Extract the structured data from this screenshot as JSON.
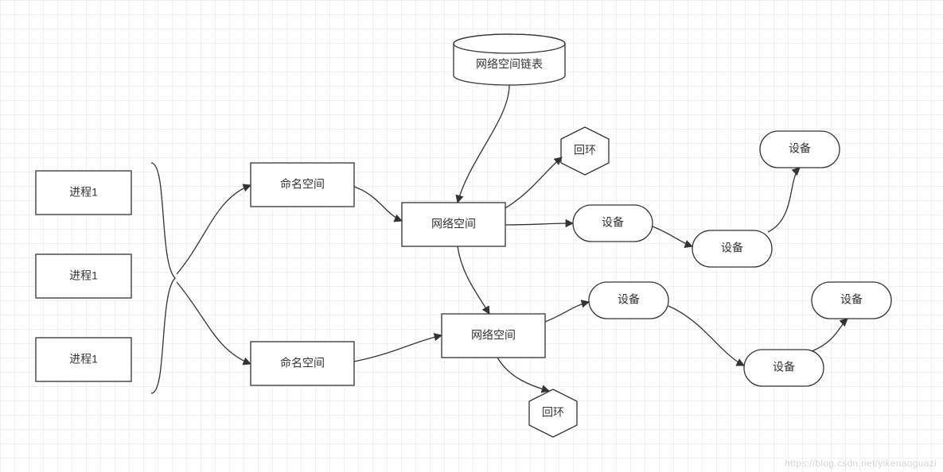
{
  "nodes": {
    "proc1": "进程1",
    "proc2": "进程1",
    "proc3": "进程1",
    "ns1": "命名空间",
    "ns2": "命名空间",
    "net1": "网络空间",
    "net2": "网络空间",
    "netlist": "网络空间链表",
    "loop1": "回环",
    "loop2": "回环",
    "devA": "设备",
    "devB": "设备",
    "devC": "设备",
    "devD": "设备",
    "devE": "设备",
    "devF": "设备"
  },
  "watermark": "https://blog.csdn.net/yikenaoguazi"
}
